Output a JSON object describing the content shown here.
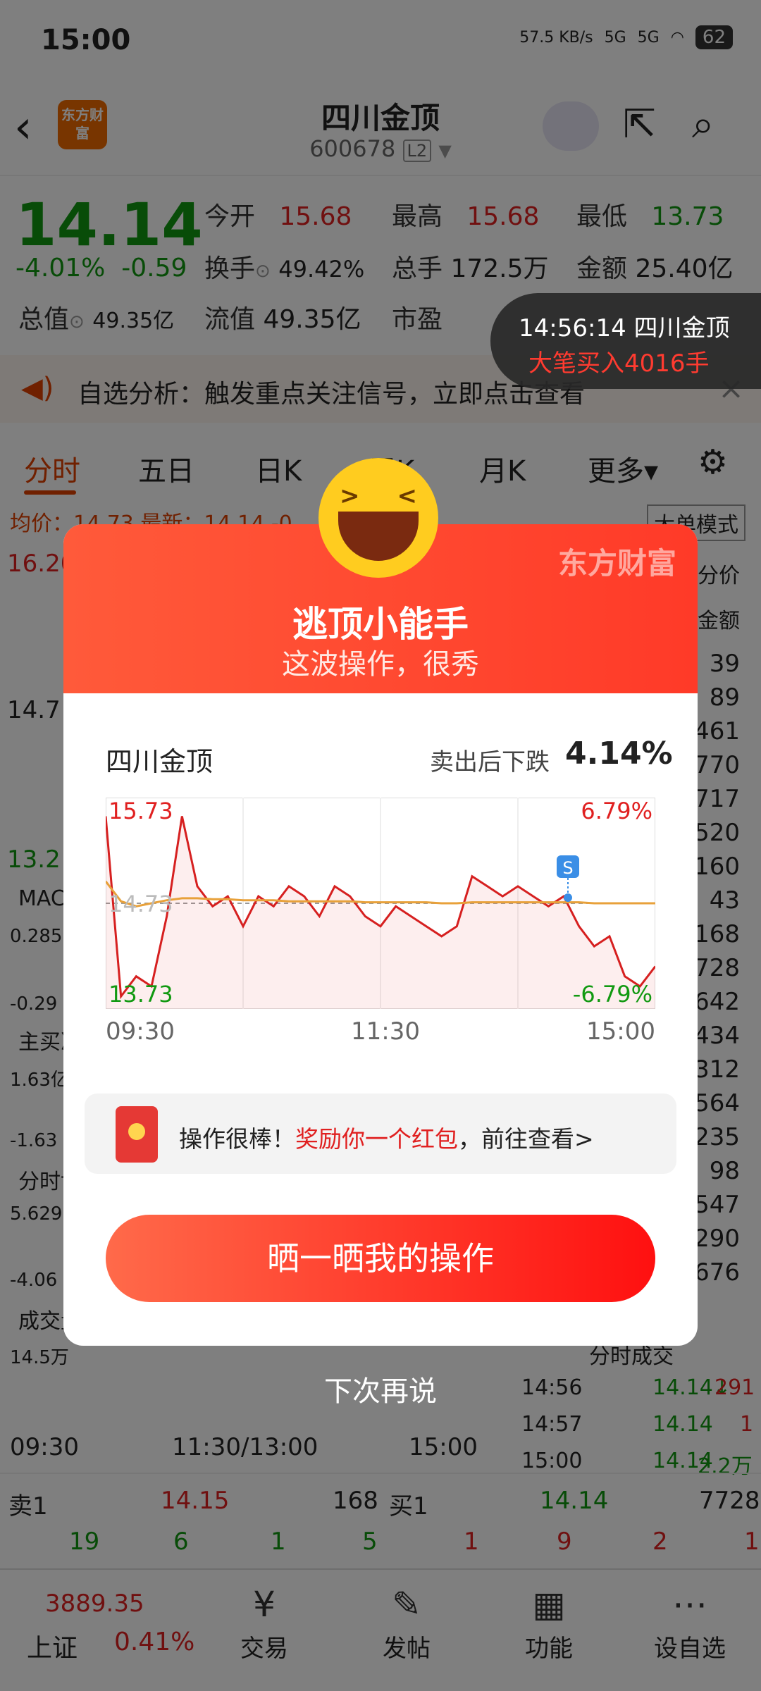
{
  "status": {
    "time": "15:00",
    "net_speed": "57.5 KB/s",
    "net1": "5G",
    "net2": "5G",
    "battery": "62"
  },
  "header": {
    "logo": "东方财富",
    "stock_name": "四川金顶",
    "stock_code": "600678",
    "level": "L2"
  },
  "quote": {
    "price": "14.14",
    "change_pct": "-4.01%",
    "change_abs": "-0.59",
    "open_label": "今开",
    "open_value": "15.68",
    "high_label": "最高",
    "high_value": "15.68",
    "low_label": "最低",
    "low_value": "13.73",
    "turnover_label": "换手",
    "turnover_value": "49.42%",
    "volume_label": "总手",
    "volume_value": "172.5万",
    "amount_label": "金额",
    "amount_value": "25.40亿",
    "mcap_label": "总值",
    "mcap_value": "49.35亿",
    "float_label": "流值",
    "float_value": "49.35亿",
    "pe_label": "市盈"
  },
  "banner": {
    "text": "自选分析：触发重点关注信号，立即点击查看"
  },
  "toast": {
    "line1": "14:56:14  四川金顶",
    "line2": "大笔买入4016手"
  },
  "tabs": [
    "分时",
    "五日",
    "日K",
    "周K",
    "月K",
    "更多▾"
  ],
  "bg": {
    "avg_line": "均价：14.73  最新：14.14  -0",
    "mode": "大单模式",
    "top_price": "16.20",
    "mid_price": "14.7",
    "low_price": "13.2",
    "macd": "MAC",
    "macd_v": "0.285",
    "macd_n": "-0.29",
    "main_buy": "主买净",
    "main_v": "1.63亿",
    "main_n": "-1.63",
    "game": "分时博",
    "game_v": "5.629",
    "game_n": "-4.06",
    "vol": "成交量",
    "vol_v": "14.5万",
    "time_axis": [
      "09:30",
      "11:30/13:00",
      "15:00"
    ],
    "right_head1": "分价",
    "right_head2": "金额",
    "right_vals": [
      "39",
      "89",
      "461",
      "770",
      "717",
      "520",
      "160",
      "43",
      "168",
      "728",
      "642",
      "434",
      "312",
      "564",
      "235",
      "98",
      "547",
      "290",
      "676"
    ],
    "ticks_title": "分时成交",
    "ticks": [
      {
        "t": "14:56",
        "p": "14.14↓",
        "v": "291"
      },
      {
        "t": "14:57",
        "p": "14.14",
        "v": "1"
      },
      {
        "t": "15:00",
        "p": "14.14",
        "v": "2.2万"
      }
    ]
  },
  "orderbook": {
    "sell_label": "卖1",
    "sell_price": "14.15",
    "sell_vol": "168",
    "buy_label": "买1",
    "buy_price": "14.14",
    "buy_vol": "7728",
    "row2": [
      "19",
      "6",
      "1",
      "5",
      "1",
      "9",
      "2",
      "1"
    ]
  },
  "nav": {
    "index_value": "3889.35",
    "index_name": "上证",
    "index_pct": "0.41%",
    "items": [
      "交易",
      "发帖",
      "功能",
      "设自选"
    ]
  },
  "modal": {
    "brand": "东方财富",
    "title": "逃顶小能手",
    "subtitle": "这波操作，很秀",
    "stock": "四川金顶",
    "drop_label": "卖出后下跌",
    "drop_value": "4.14%",
    "chart": {
      "high": "15.73",
      "low": "13.73",
      "high_pct": "6.79%",
      "low_pct": "-6.79%",
      "ref": "14.73",
      "marker": "S",
      "times": [
        "09:30",
        "11:30",
        "15:00"
      ]
    },
    "reward_prefix": "操作很棒！",
    "reward_highlight": "奖励你一个红包",
    "reward_suffix": "，前往查看>",
    "cta": "晒一晒我的操作",
    "later": "下次再说"
  },
  "colors": {
    "up": "#e02020",
    "down": "#119911",
    "accent": "#e04000"
  },
  "chart_data": {
    "type": "line",
    "ylim": [
      13.73,
      15.73
    ],
    "x_ticks": [
      "09:30",
      "11:30",
      "15:00"
    ],
    "series": [
      {
        "values": [
          15.6,
          13.8,
          14.0,
          13.9,
          14.6,
          15.6,
          14.9,
          14.7,
          14.8,
          14.5,
          14.8,
          14.7,
          14.9,
          14.8,
          14.6,
          14.9,
          14.8,
          14.6,
          14.5,
          14.7,
          14.6,
          14.5,
          14.4,
          14.5,
          15.0,
          14.9,
          14.8,
          14.9,
          14.8,
          14.7,
          14.8,
          14.5,
          14.3,
          14.4,
          14.0,
          13.9,
          14.1
        ]
      },
      {
        "values": [
          14.95,
          14.75,
          14.7,
          14.73,
          14.76,
          14.78,
          14.78,
          14.77,
          14.77,
          14.76,
          14.76,
          14.76,
          14.75,
          14.75,
          14.75,
          14.75,
          14.75,
          14.74,
          14.74,
          14.74,
          14.74,
          14.74,
          14.73,
          14.73,
          14.74,
          14.74,
          14.74,
          14.74,
          14.74,
          14.74,
          14.74,
          14.74,
          14.73,
          14.73,
          14.73,
          14.73,
          14.73
        ]
      }
    ]
  }
}
